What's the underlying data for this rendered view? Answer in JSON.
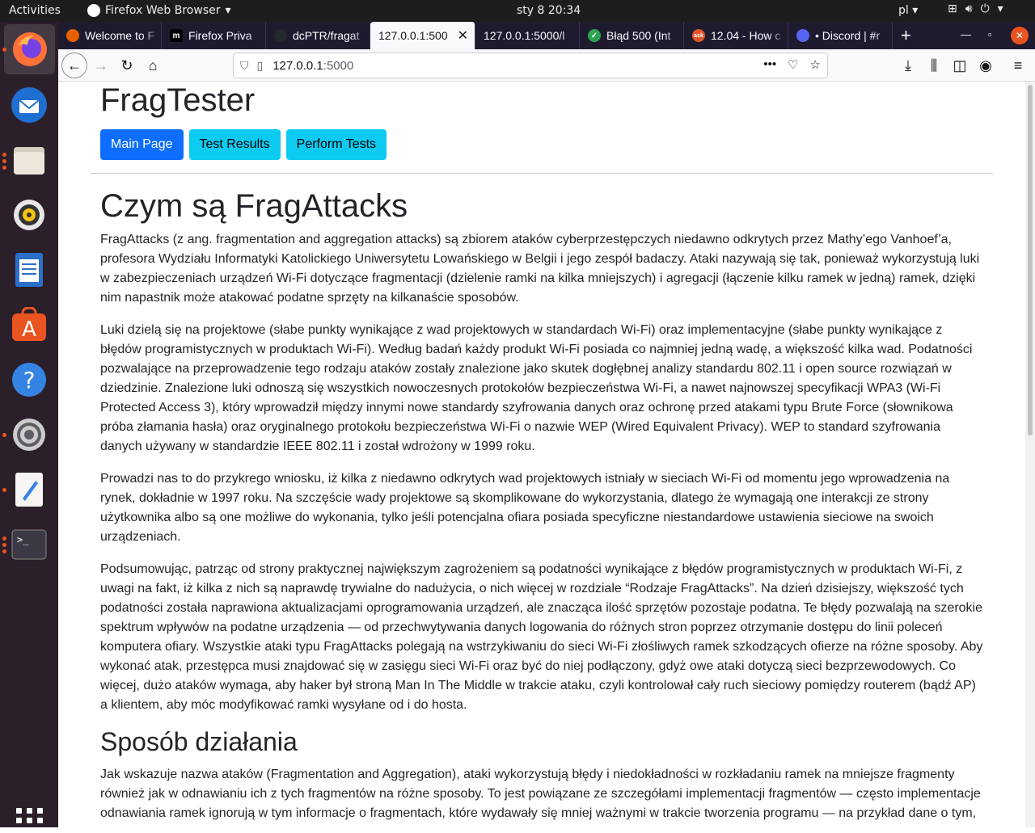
{
  "topbar": {
    "activities": "Activities",
    "app_name": "Firefox Web Browser",
    "clock": "sty 8  20:34",
    "lang": "pl"
  },
  "dock": {
    "items": [
      "firefox",
      "thunderbird",
      "files",
      "rhythmbox",
      "libreoffice-writer",
      "software-center",
      "help",
      "settings",
      "text-editor",
      "terminal"
    ]
  },
  "tabs": [
    {
      "label": "Welcome to F",
      "favicon_color": "#e66000"
    },
    {
      "label": "Firefox Priva",
      "favicon_color": "#000000"
    },
    {
      "label": "dcPTR/fragat",
      "favicon_color": "#24292e"
    },
    {
      "label": "127.0.0.1:500",
      "favicon_color": "",
      "active": true
    },
    {
      "label": "127.0.0.1:5000/l",
      "favicon_color": ""
    },
    {
      "label": "Błąd 500 (Int",
      "favicon_color": "#2ea44f"
    },
    {
      "label": "12.04 - How c",
      "favicon_color": "#e2542c"
    },
    {
      "label": "• Discord | #r",
      "favicon_color": "#5865f2"
    }
  ],
  "url": {
    "host": "127.0.0.1",
    "port": ":5000"
  },
  "page": {
    "site_title": "FragTester",
    "nav_buttons": {
      "main": "Main Page",
      "results": "Test Results",
      "perform": "Perform Tests"
    },
    "heading": "Czym są FragAttacks",
    "paragraphs": [
      "FragAttacks (z ang. fragmentation and aggregation attacks) są zbiorem ataków cyberprzestępczych niedawno odkrytych przez Mathy’ego Vanhoef’a, profesora Wydziału Informatyki Katolickiego Uniwersytetu Lowańskiego w Belgii i jego zespół badaczy. Ataki nazywają się tak, ponieważ wykorzystują luki w zabezpieczeniach urządzeń Wi-Fi dotyczące fragmentacji (dzielenie ramki na kilka mniejszych) i agregacji (łączenie kilku ramek w jedną) ramek, dzięki nim napastnik może atakować podatne sprzęty na kilkanaście sposobów.",
      "Luki dzielą się na projektowe (słabe punkty wynikające z wad projektowych w standardach Wi-Fi) oraz implementacyjne (słabe punkty wynikające z błędów programistycznych w produktach Wi-Fi). Według badań każdy produkt Wi-Fi posiada co najmniej jedną wadę, a większość kilka wad. Podatności pozwalające na przeprowadzenie tego rodzaju ataków zostały znalezione jako skutek dogłębnej analizy standardu 802.11 i open source rozwiązań w dziedzinie. Znalezione luki odnoszą się wszystkich nowoczesnych protokołów bezpieczeństwa Wi-Fi, a nawet najnowszej specyfikacji WPA3 (Wi-Fi Protected Access 3), który wprowadził między innymi nowe standardy szyfrowania danych oraz ochronę przed atakami typu Brute Force (słownikowa próba złamania hasła) oraz oryginalnego protokołu bezpieczeństwa Wi-Fi o nazwie WEP (Wired Equivalent Privacy). WEP to standard szyfrowania danych używany w standardzie IEEE 802.11 i został wdrożony w 1999 roku.",
      "Prowadzi nas to do przykrego wniosku, iż kilka z niedawno odkrytych wad projektowych istniały w sieciach Wi-Fi od momentu jego wprowadzenia na rynek, dokładnie w 1997 roku. Na szczęście wady projektowe są skomplikowane do wykorzystania, dlatego że wymagają one interakcji ze strony użytkownika albo są one możliwe do wykonania, tylko jeśli potencjalna ofiara posiada specyficzne niestandardowe ustawienia sieciowe na swoich urządzeniach.",
      "Podsumowując, patrząc od strony praktycznej największym zagrożeniem są podatności wynikające z błędów programistycznych w produktach Wi-Fi, z uwagi na fakt, iż kilka z nich są naprawdę trywialne do nadużycia, o nich więcej w rozdziale “Rodzaje FragAttacks”. Na dzień dzisiejszy, większość tych podatności została naprawiona aktualizacjami oprogramowania urządzeń, ale znacząca ilość sprzętów pozostaje podatna. Te błędy pozwalają na szerokie spektrum wpływów na podatne urządzenia — od przechwytywania danych logowania do różnych stron poprzez otrzymanie dostępu do linii poleceń komputera ofiary. Wszystkie ataki typu FragAttacks polegają na wstrzykiwaniu do sieci Wi-Fi złośliwych ramek szkodzących ofierze na różne sposoby. Aby wykonać atak, przestępca musi znajdować się w zasięgu sieci Wi-Fi oraz być do niej podłączony, gdyż owe ataki dotyczą sieci bezprzewodowych. Co więcej, dużo ataków wymaga, aby haker był stroną Man In The Middle w trakcie ataku, czyli kontrolował cały ruch sieciowy pomiędzy routerem (bądź AP) a klientem, aby móc modyfikować ramki wysyłane od i do hosta."
    ],
    "heading2": "Sposób działania",
    "paragraph5": "Jak wskazuje nazwa ataków (Fragmentation and Aggregation), ataki wykorzystują błędy i niedokładności w rozkładaniu ramek na mniejsze fragmenty również jak w odnawianiu ich z tych fragmentów na różne sposoby. To jest powiązane ze szczegółami implementacji fragmentów — często implementacje odnawiania ramek ignorują w tym informacje o fragmentach, które wydawały się mniej ważnymi w trakcie tworzenia programu — na przykład dane o tym,"
  }
}
